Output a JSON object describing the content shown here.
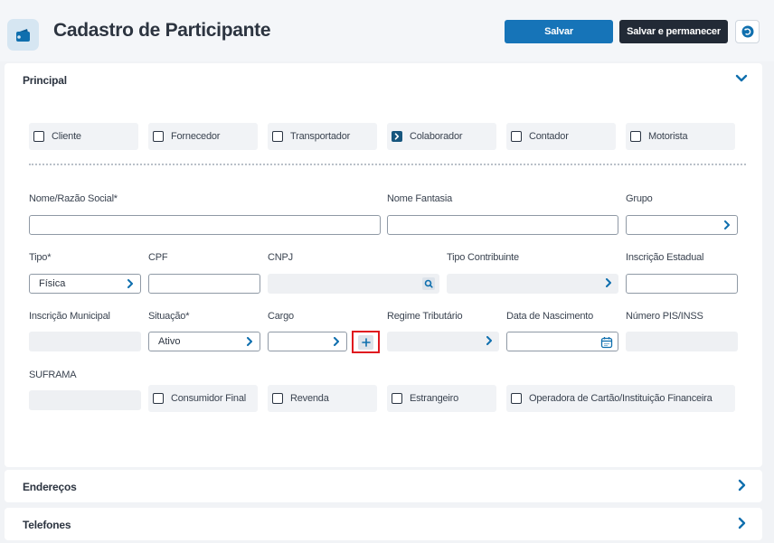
{
  "header": {
    "title": "Cadastro de Participante",
    "save_label": "Salvar",
    "save_stay_label": "Salvar e permanecer",
    "app_icon": "wallet-icon",
    "undo_icon": "undo-icon"
  },
  "colors": {
    "primary": "#1674b8",
    "dark": "#222a36",
    "accent": "#0f6fae",
    "highlight": "#e0171f"
  },
  "sections": {
    "principal": "Principal",
    "enderecos": "Endereços",
    "telefones": "Telefones"
  },
  "roles": [
    {
      "label": "Cliente",
      "checked": false
    },
    {
      "label": "Fornecedor",
      "checked": false
    },
    {
      "label": "Transportador",
      "checked": false
    },
    {
      "label": "Colaborador",
      "checked": true
    },
    {
      "label": "Contador",
      "checked": false
    },
    {
      "label": "Motorista",
      "checked": false
    }
  ],
  "fields": {
    "nome": {
      "label": "Nome/Razão Social*",
      "value": ""
    },
    "fantasia": {
      "label": "Nome Fantasia",
      "value": ""
    },
    "grupo": {
      "label": "Grupo",
      "value": ""
    },
    "tipo": {
      "label": "Tipo*",
      "value": "Física"
    },
    "cpf": {
      "label": "CPF",
      "value": ""
    },
    "cnpj": {
      "label": "CNPJ",
      "value": ""
    },
    "tipo_contribuinte": {
      "label": "Tipo Contribuinte",
      "value": ""
    },
    "inscricao_estadual": {
      "label": "Inscrição Estadual",
      "value": ""
    },
    "inscricao_municipal": {
      "label": "Inscrição Municipal",
      "value": ""
    },
    "situacao": {
      "label": "Situação*",
      "value": "Ativo"
    },
    "cargo": {
      "label": "Cargo",
      "value": ""
    },
    "regime": {
      "label": "Regime Tributário",
      "value": ""
    },
    "nascimento": {
      "label": "Data de Nascimento",
      "value": ""
    },
    "pis": {
      "label": "Número PIS/INSS",
      "value": ""
    },
    "suframa": {
      "label": "SUFRAMA",
      "value": ""
    }
  },
  "options": [
    {
      "label": "Consumidor Final",
      "checked": false
    },
    {
      "label": "Revenda",
      "checked": false
    },
    {
      "label": "Estrangeiro",
      "checked": false
    },
    {
      "label": "Operadora de Cartão/Instituição Financeira",
      "checked": false
    }
  ]
}
